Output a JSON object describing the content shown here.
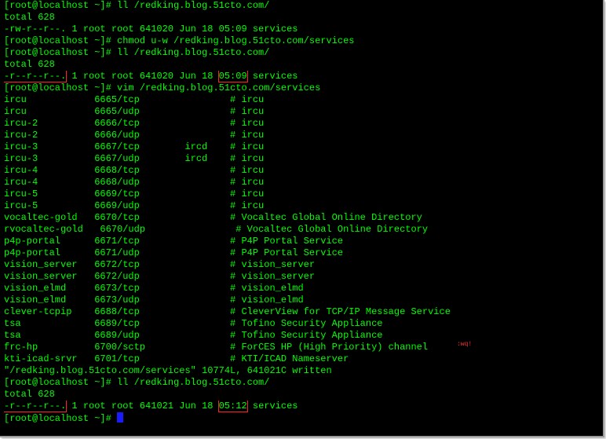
{
  "terminal": {
    "text_color": "#00ff00",
    "background": "#000000",
    "highlight_color": "#ff2020",
    "cursor_color": "#1a1aff"
  },
  "lines": [
    "[root@localhost ~]# ll /redking.blog.51cto.com/",
    "total 628",
    "-rw-r--r--. 1 root root 641020 Jun 18 05:09 services",
    "[root@localhost ~]# chmod u-w /redking.blog.51cto.com/services",
    "[root@localhost ~]# ll /redking.blog.51cto.com/",
    "total 628",
    {
      "segments": [
        "-r--r--r--.",
        " 1 root root 641020 Jun 18 ",
        "05:09",
        " services"
      ]
    },
    "[root@localhost ~]# vim /redking.blog.51cto.com/services",
    "ircu            6665/tcp                # ircu",
    "ircu            6665/udp                # ircu",
    "ircu-2          6666/tcp                # ircu",
    "ircu-2          6666/udp                # ircu",
    "ircu-3          6667/tcp        ircd    # ircu",
    "ircu-3          6667/udp        ircd    # ircu",
    "ircu-4          6668/tcp                # ircu",
    "ircu-4          6668/udp                # ircu",
    "ircu-5          6669/tcp                # ircu",
    "ircu-5          6669/udp                # ircu",
    "vocaltec-gold   6670/tcp                # Vocaltec Global Online Directory",
    "rvocaltec-gold   6670/udp                # Vocaltec Global Online Directory",
    "p4p-portal      6671/tcp                # P4P Portal Service",
    "p4p-portal      6671/udp                # P4P Portal Service",
    "vision_server   6672/tcp                # vision_server",
    "vision_server   6672/udp                # vision_server",
    "vision_elmd     6673/tcp                # vision_elmd",
    "vision_elmd     6673/udp                # vision_elmd",
    "clever-tcpip    6688/tcp                # CleverView for TCP/IP Message Service",
    "tsa             6689/tcp                # Tofino Security Appliance",
    "tsa             6689/udp                # Tofino Security Appliance",
    "frc-hp          6700/sctp               # ForCES HP (High Priority) channel",
    "kti-icad-srvr   6701/tcp                # KTI/ICAD Nameserver",
    "\"/redking.blog.51cto.com/services\" 10774L, 641021C written",
    "[root@localhost ~]# ll /redking.blog.51cto.com/",
    "total 628",
    {
      "segments": [
        "-r--r--r--.",
        " 1 root root 641021 Jun 18 ",
        "05:12",
        " services"
      ]
    },
    "[root@localhost ~]# "
  ],
  "annotation": ":wq!"
}
